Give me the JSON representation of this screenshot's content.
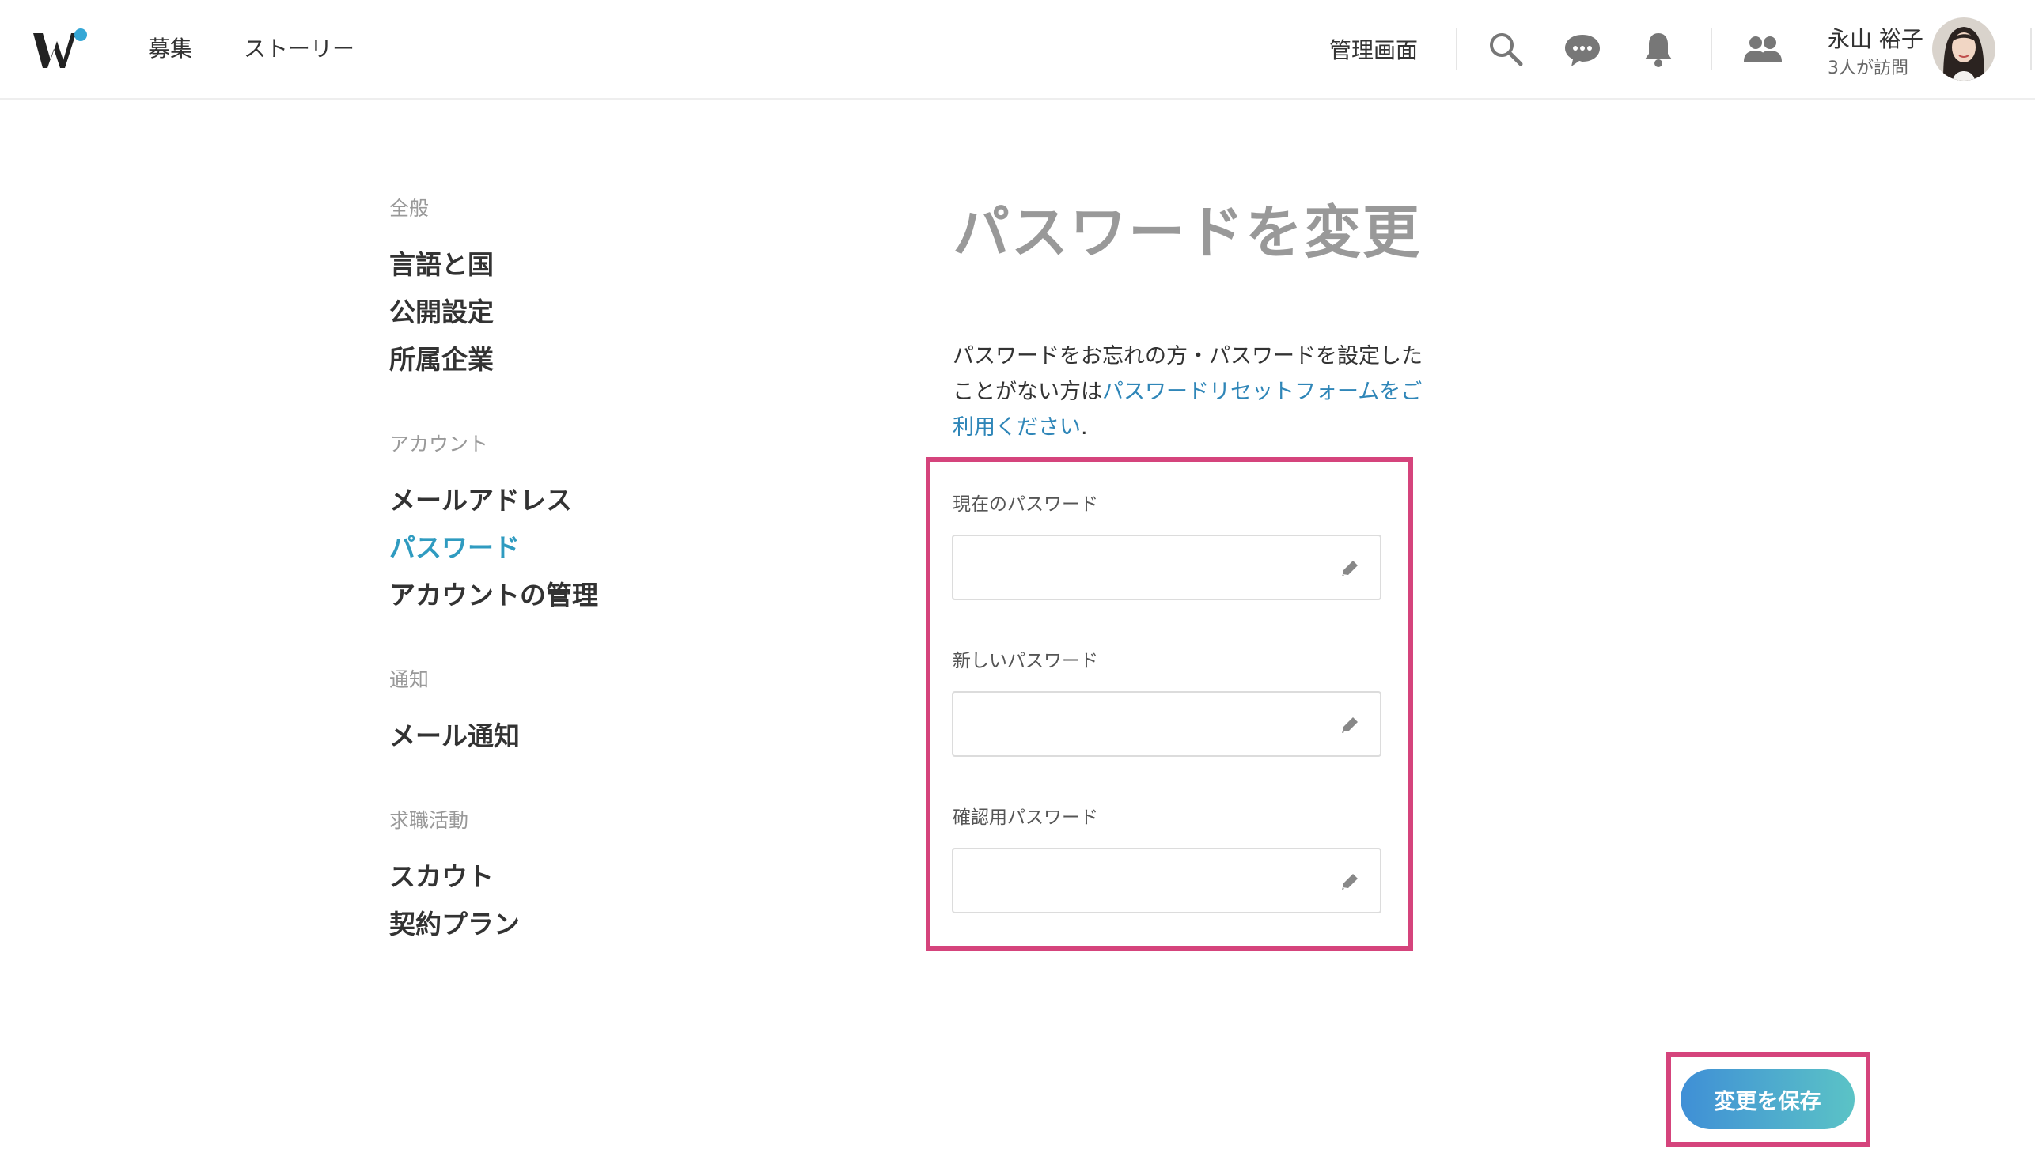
{
  "header": {
    "nav": {
      "recruit": "募集",
      "story": "ストーリー"
    },
    "admin": "管理画面",
    "user": {
      "name": "永山 裕子",
      "visits": "3人が訪問"
    }
  },
  "sidebar": {
    "sections": [
      {
        "title": "全般",
        "items": [
          "言語と国",
          "公開設定",
          "所属企業"
        ]
      },
      {
        "title": "アカウント",
        "items": [
          "メールアドレス",
          "パスワード",
          "アカウントの管理"
        ]
      },
      {
        "title": "通知",
        "items": [
          "メール通知"
        ]
      },
      {
        "title": "求職活動",
        "items": [
          "スカウト",
          "契約プラン"
        ]
      }
    ],
    "active": "パスワード"
  },
  "main": {
    "title": "パスワードを変更",
    "info": {
      "text_before": "パスワードをお忘れの方・パスワードを設定したことがない方は",
      "link": "パスワードリセットフォームをご利用ください",
      "text_after": "."
    },
    "fields": {
      "current": {
        "label": "現在のパスワード",
        "value": ""
      },
      "new": {
        "label": "新しいパスワード",
        "value": ""
      },
      "confirm": {
        "label": "確認用パスワード",
        "value": ""
      }
    },
    "save_label": "変更を保存"
  },
  "colors": {
    "accent": "#2f9bc0",
    "highlight": "#d5447c",
    "button_start": "#3f8fd6",
    "button_end": "#5bc3c6"
  }
}
